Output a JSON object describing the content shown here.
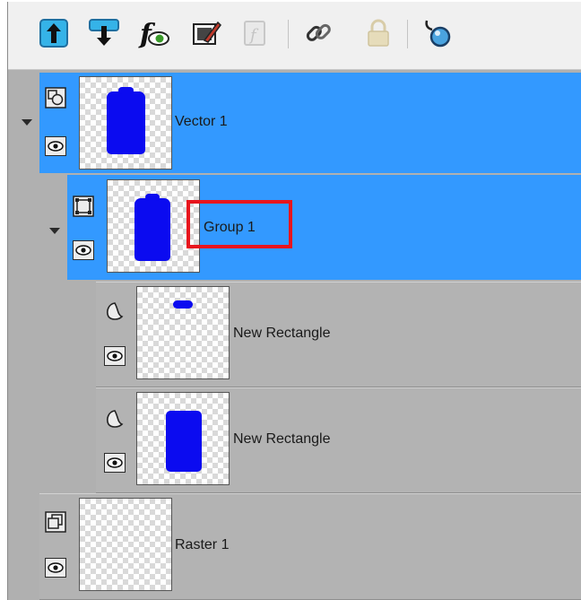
{
  "toolbar": {
    "buttons": [
      {
        "icon": "move-layer-up-icon",
        "enabled": true
      },
      {
        "icon": "move-layer-down-icon",
        "enabled": true
      },
      {
        "icon": "layer-effects-icon",
        "enabled": true
      },
      {
        "icon": "edit-layer-icon",
        "enabled": true
      },
      {
        "icon": "script-icon",
        "enabled": false
      },
      {
        "icon": "link-icon",
        "enabled": true
      },
      {
        "icon": "lock-icon",
        "enabled": false
      },
      {
        "icon": "layer-options-icon",
        "enabled": true
      }
    ]
  },
  "layers": [
    {
      "name": "Vector 1",
      "type": "vector-layer-icon",
      "visible": true,
      "expanded": true,
      "selected": true
    },
    {
      "name": "Group 1",
      "type": "group-icon",
      "visible": true,
      "expanded": true,
      "selected": true
    },
    {
      "name": "New Rectangle",
      "type": "vector-object-icon",
      "visible": true,
      "selected": false
    },
    {
      "name": "New Rectangle",
      "type": "vector-object-icon",
      "visible": true,
      "selected": false
    },
    {
      "name": "Raster 1",
      "type": "raster-layer-icon",
      "visible": true,
      "selected": false
    }
  ],
  "colors": {
    "selection": "#3399ff",
    "shape_fill": "#0b0bf0",
    "highlight": "#e8151d",
    "unselected_row": "#b3b3b3"
  }
}
